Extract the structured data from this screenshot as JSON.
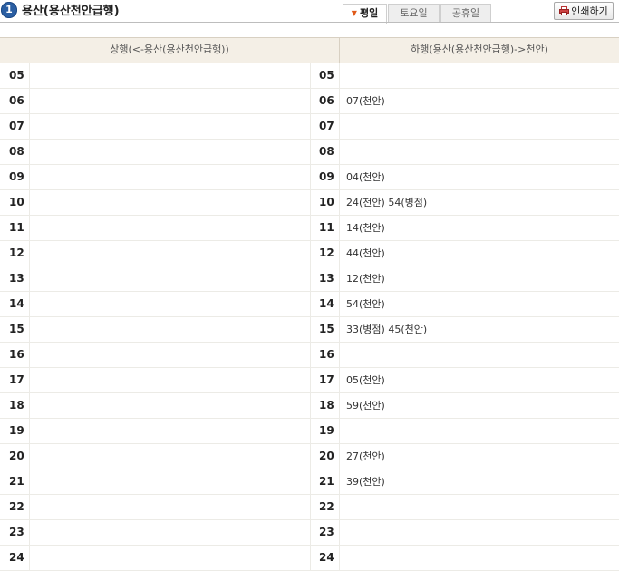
{
  "header": {
    "badge_number": "1",
    "station_title": "용산(용산천안급행)",
    "tabs": [
      {
        "label": "평일",
        "active": true
      },
      {
        "label": "토요일",
        "active": false
      },
      {
        "label": "공휴일",
        "active": false
      }
    ],
    "print_label": "인쇄하기"
  },
  "table": {
    "col_up": "상행(<-용산(용산천안급행))",
    "col_down": "하행(용산(용산천안급행)->천안)",
    "rows": [
      {
        "hour": "05",
        "up": "",
        "down": ""
      },
      {
        "hour": "06",
        "up": "",
        "down": "07(천안)"
      },
      {
        "hour": "07",
        "up": "",
        "down": ""
      },
      {
        "hour": "08",
        "up": "",
        "down": ""
      },
      {
        "hour": "09",
        "up": "",
        "down": "04(천안)"
      },
      {
        "hour": "10",
        "up": "",
        "down": "24(천안) 54(병점)"
      },
      {
        "hour": "11",
        "up": "",
        "down": "14(천안)"
      },
      {
        "hour": "12",
        "up": "",
        "down": "44(천안)"
      },
      {
        "hour": "13",
        "up": "",
        "down": "12(천안)"
      },
      {
        "hour": "14",
        "up": "",
        "down": "54(천안)"
      },
      {
        "hour": "15",
        "up": "",
        "down": "33(병점) 45(천안)"
      },
      {
        "hour": "16",
        "up": "",
        "down": ""
      },
      {
        "hour": "17",
        "up": "",
        "down": "05(천안)"
      },
      {
        "hour": "18",
        "up": "",
        "down": "59(천안)"
      },
      {
        "hour": "19",
        "up": "",
        "down": ""
      },
      {
        "hour": "20",
        "up": "",
        "down": "27(천안)"
      },
      {
        "hour": "21",
        "up": "",
        "down": "39(천안)"
      },
      {
        "hour": "22",
        "up": "",
        "down": ""
      },
      {
        "hour": "23",
        "up": "",
        "down": ""
      },
      {
        "hour": "24",
        "up": "",
        "down": ""
      }
    ]
  },
  "colors": {
    "badge": "#2b5fa3",
    "active_arrow": "#e05a1a",
    "header_bg": "#f4efe6"
  }
}
